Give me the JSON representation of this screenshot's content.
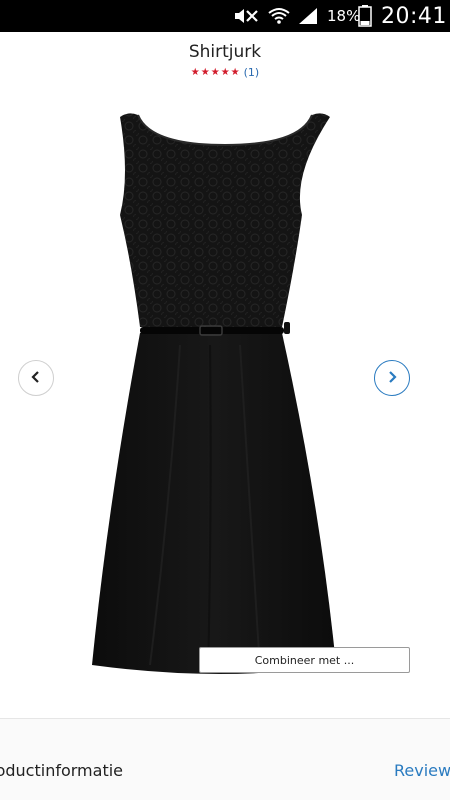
{
  "status_bar": {
    "battery_percent": "18%",
    "time": "20:41",
    "icons": [
      "mute-icon",
      "wifi-icon",
      "signal-icon",
      "battery-icon"
    ]
  },
  "product": {
    "title": "Shirtjurk",
    "rating_stars": 5,
    "review_count": "(1)",
    "image_alt": "black-lace-dress-with-belt",
    "colors": {
      "star": "#d21c2c",
      "link": "#2a7bc0"
    }
  },
  "carousel": {
    "prev_icon": "chevron-left-icon",
    "next_icon": "chevron-right-icon"
  },
  "combine_button": {
    "label": "Combineer met ..."
  },
  "tabs": {
    "info_label": "Productinformatie",
    "reviews_label": "Reviews"
  }
}
